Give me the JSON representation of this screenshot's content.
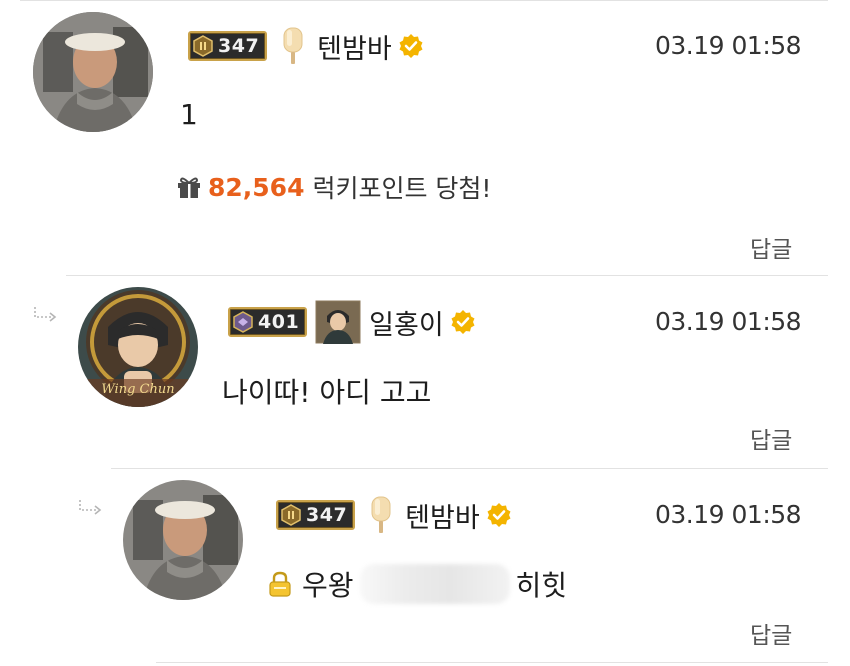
{
  "comments": [
    {
      "level": "347",
      "nickname": "텐밤바",
      "timestamp": "03.19 01:58",
      "text": "1",
      "lucky": {
        "points": "82,564",
        "label": "럭키포인트 당첨!"
      },
      "reply_label": "답글"
    },
    {
      "level": "401",
      "nickname": "일홍이",
      "timestamp": "03.19 01:58",
      "text": "나이따! 아디 고고",
      "avatar_caption": "Wing Chun",
      "reply_label": "답글"
    },
    {
      "level": "347",
      "nickname": "텐밤바",
      "timestamp": "03.19 01:58",
      "text_before": "우왕",
      "text_after": "히힛",
      "reply_label": "답글"
    }
  ],
  "colors": {
    "accent_points": "#e8601c",
    "verified": "#f4b400",
    "badge_border": "#c9a24a"
  },
  "icons": [
    "level-badge-icon",
    "ice-cream-bar-icon",
    "verified-icon",
    "gift-icon",
    "reply-arrow-icon",
    "lock-icon",
    "avatar-item-icon"
  ]
}
